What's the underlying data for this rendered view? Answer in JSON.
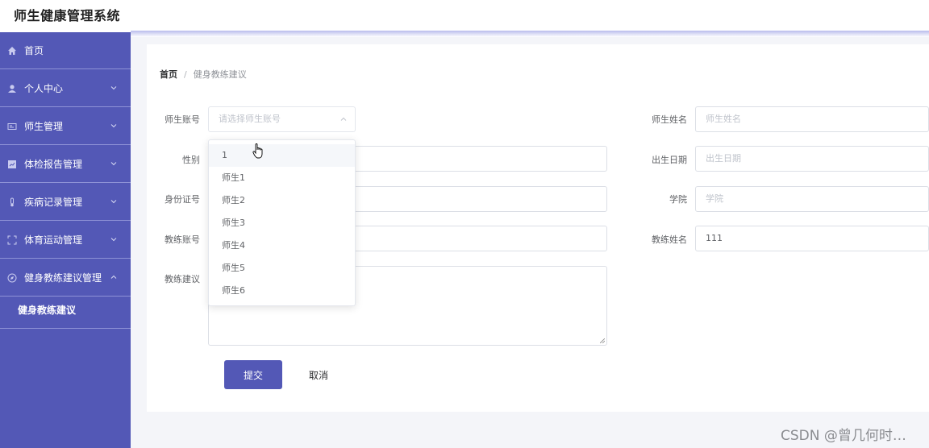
{
  "app": {
    "title": "师生健康管理系统"
  },
  "sidebar": {
    "items": [
      {
        "label": "首页",
        "icon": "home-icon"
      },
      {
        "label": "个人中心",
        "icon": "user-icon"
      },
      {
        "label": "师生管理",
        "icon": "id-card-icon"
      },
      {
        "label": "体检报告管理",
        "icon": "report-icon"
      },
      {
        "label": "疾病记录管理",
        "icon": "thermometer-icon"
      },
      {
        "label": "体育运动管理",
        "icon": "fullscreen-icon"
      },
      {
        "label": "健身教练建议管理",
        "icon": "compass-icon"
      }
    ],
    "sub_item": "健身教练建议",
    "colors": {
      "background": "#5358b6",
      "divider": "#8e92d6"
    }
  },
  "breadcrumb": {
    "home": "首页",
    "separator": "/",
    "current": "健身教练建议"
  },
  "form": {
    "account_label": "师生账号",
    "account_placeholder": "请选择师生账号",
    "name_label": "师生姓名",
    "name_placeholder": "师生姓名",
    "gender_label": "性别",
    "birth_label": "出生日期",
    "birth_placeholder": "出生日期",
    "id_label": "身份证号",
    "college_label": "学院",
    "college_placeholder": "学院",
    "coach_account_label": "教练账号",
    "coach_name_label": "教练姓名",
    "coach_name_value": "111",
    "advice_label": "教练建议",
    "submit_label": "提交",
    "cancel_label": "取消"
  },
  "dropdown": {
    "options": [
      "1",
      "师生1",
      "师生2",
      "师生3",
      "师生4",
      "师生5",
      "师生6"
    ],
    "hovered": "1"
  },
  "watermark": "CSDN @曾几何时…"
}
